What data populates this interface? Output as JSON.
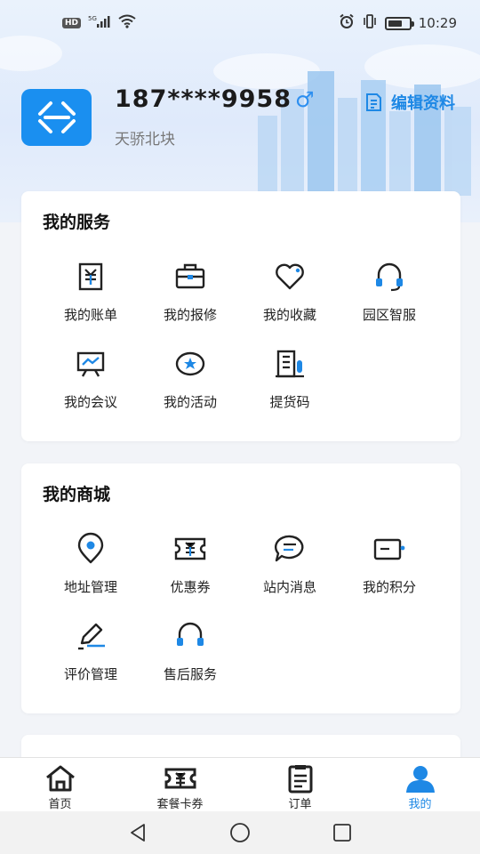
{
  "status_bar": {
    "hd": "HD",
    "signal_label": "5G",
    "time": "10:29",
    "icons": [
      "signal-icon",
      "wifi-icon",
      "alarm-icon",
      "vibrate-icon",
      "battery-icon"
    ]
  },
  "profile": {
    "phone": "187****9958",
    "gender_symbol": "♂",
    "location": "天骄北块",
    "edit_label": "编辑资料"
  },
  "services": {
    "title": "我的服务",
    "items": [
      {
        "label": "我的账单",
        "icon": "bill-icon"
      },
      {
        "label": "我的报修",
        "icon": "toolbox-icon"
      },
      {
        "label": "我的收藏",
        "icon": "heart-icon"
      },
      {
        "label": "园区智服",
        "icon": "headset-icon"
      },
      {
        "label": "我的会议",
        "icon": "presentation-icon"
      },
      {
        "label": "我的活动",
        "icon": "activity-icon"
      },
      {
        "label": "提货码",
        "icon": "building-icon"
      }
    ]
  },
  "mall": {
    "title": "我的商城",
    "items": [
      {
        "label": "地址管理",
        "icon": "location-pin-icon"
      },
      {
        "label": "优惠券",
        "icon": "coupon-icon"
      },
      {
        "label": "站内消息",
        "icon": "message-icon"
      },
      {
        "label": "我的积分",
        "icon": "points-card-icon"
      },
      {
        "label": "评价管理",
        "icon": "pen-icon"
      },
      {
        "label": "售后服务",
        "icon": "headset-icon"
      }
    ]
  },
  "bottom_nav": {
    "items": [
      {
        "label": "首页",
        "icon": "home-icon",
        "active": false
      },
      {
        "label": "套餐卡券",
        "icon": "ticket-icon",
        "active": false
      },
      {
        "label": "订单",
        "icon": "clipboard-icon",
        "active": false
      },
      {
        "label": "我的",
        "icon": "user-icon",
        "active": true
      }
    ]
  },
  "colors": {
    "accent": "#1e88e5",
    "avatar_bg": "#1a8ff0",
    "icon_dark": "#222222"
  }
}
